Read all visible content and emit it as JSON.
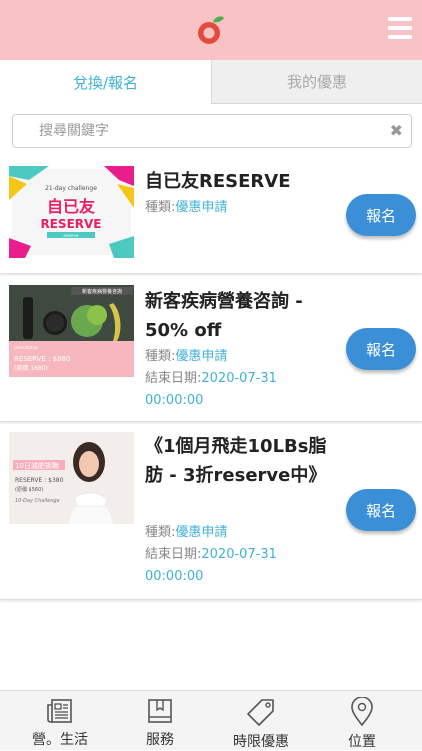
{
  "header": {
    "logo": "apple-logo",
    "menu_icon": "hamburger-menu-icon"
  },
  "tabs": [
    {
      "label": "兌換/報名",
      "active": true
    },
    {
      "label": "我的優惠",
      "active": false
    }
  ],
  "search": {
    "placeholder": "搜尋關鍵字",
    "value": "",
    "clear_icon": "close-icon"
  },
  "offers": [
    {
      "title": "自已友RESERVE",
      "type_label": "種類:",
      "type_value": "優惠申請",
      "end_label": "",
      "end_value": "",
      "button_label": "報名",
      "image": {
        "kicker": "21-day challenge",
        "line1": "自已友",
        "line2": "RESERVE",
        "small": "reserve"
      }
    },
    {
      "title": "新客疾病營養咨詢 - 50% off",
      "type_label": "種類:",
      "type_value": "優惠申請",
      "end_label": "結束日期:",
      "end_value": "2020-07-31 00:00:00",
      "button_label": "報名",
      "image": {
        "banner": "新客疾病營養咨詢",
        "small": "consultation",
        "price": "RESERVE : $880",
        "orig": "(原價 1680)"
      }
    },
    {
      "title": "《1個月飛走10LBs脂肪 - 3折reserve中》",
      "type_label": "種類:",
      "type_value": "優惠申請",
      "end_label": "結束日期:",
      "end_value": "2020-07-31 00:00:00",
      "button_label": "報名",
      "image": {
        "banner": "10日減肥挑戰",
        "price": "RESERVE : $380",
        "orig": "(原價 $560)",
        "sub": "10-Day Challenge"
      }
    }
  ],
  "bottom_nav": [
    {
      "label": "營。生活",
      "icon": "newspaper-icon",
      "active": false
    },
    {
      "label": "服務",
      "icon": "book-icon",
      "active": false
    },
    {
      "label": "時限優惠",
      "icon": "tag-icon",
      "active": true
    },
    {
      "label": "位置",
      "icon": "location-pin-icon",
      "active": false
    }
  ],
  "colors": {
    "header_bg": "#f9c2c5",
    "accent_blue": "#3fb1d9",
    "button_blue": "#3a8fd6",
    "tab_inactive_bg": "#efefef"
  }
}
